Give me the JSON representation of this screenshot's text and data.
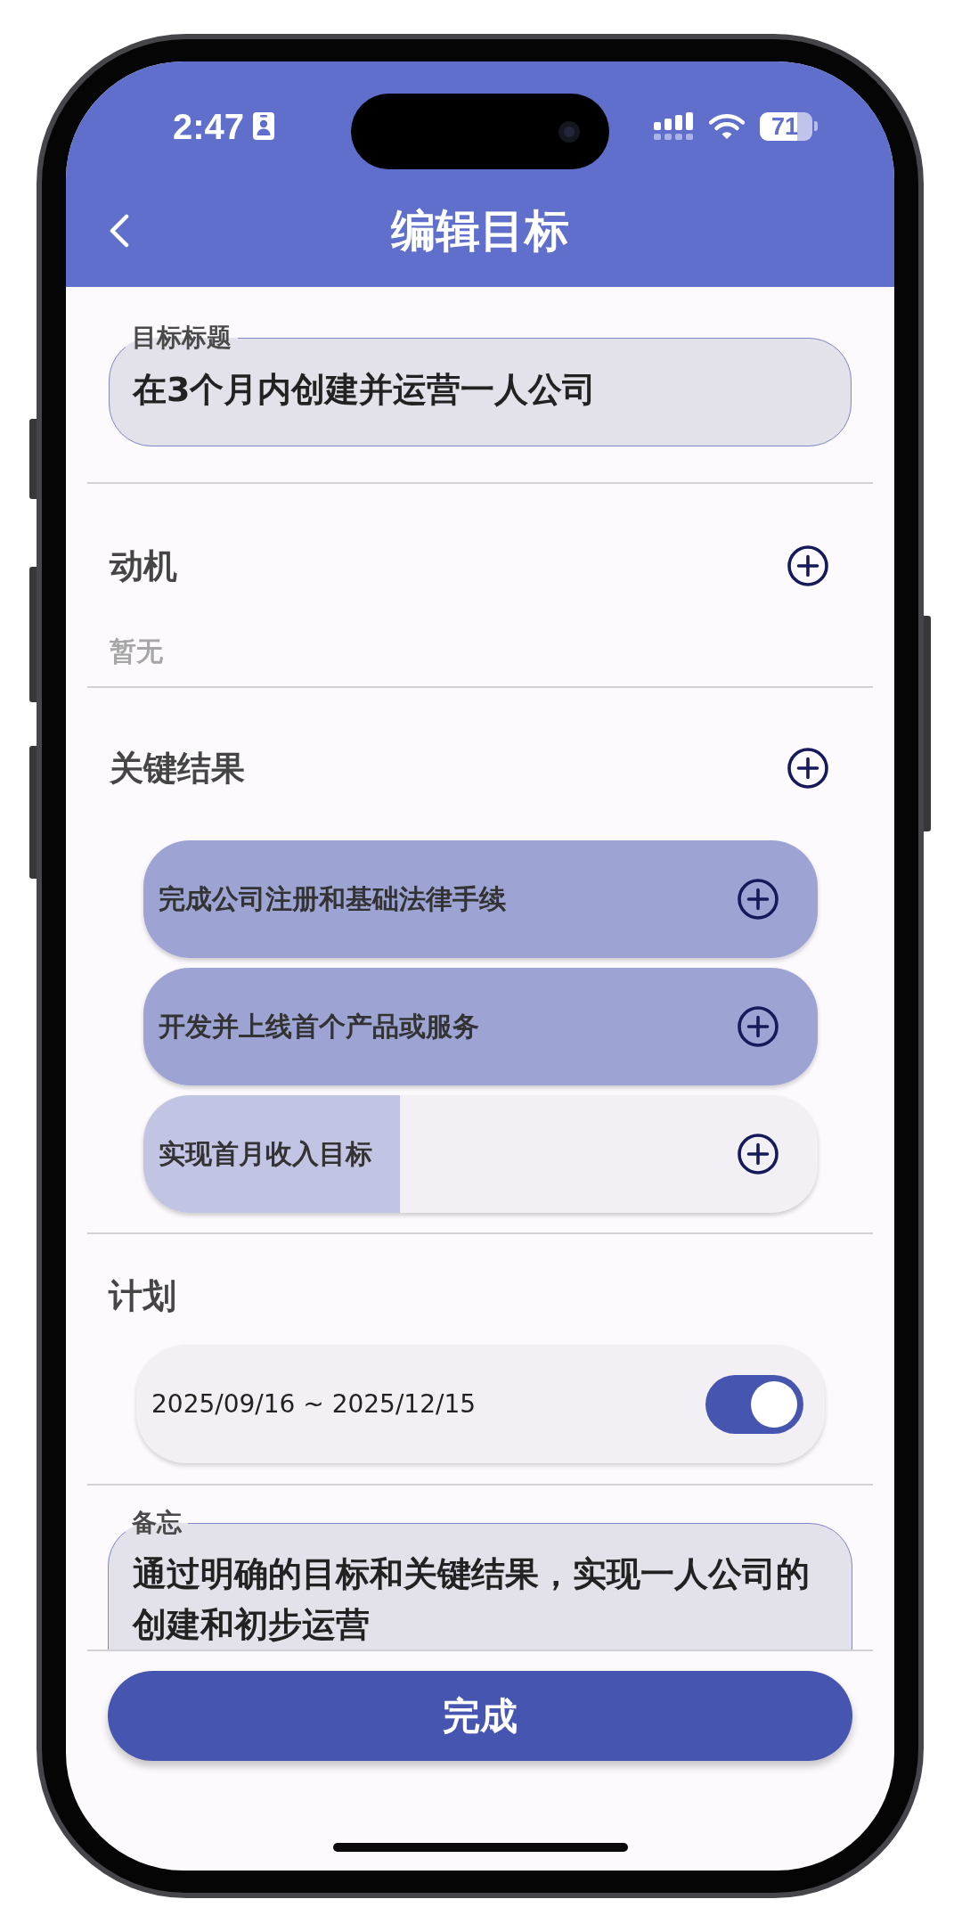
{
  "status_bar": {
    "time": "2:47",
    "battery": "71"
  },
  "header": {
    "title": "编辑目标"
  },
  "goal_title": {
    "label": "目标标题",
    "value": "在3个月内创建并运营一人公司"
  },
  "motivation": {
    "title": "动机",
    "empty_text": "暂无"
  },
  "key_results": {
    "title": "关键结果",
    "items": [
      {
        "text": "完成公司注册和基础法律手续",
        "level": 1
      },
      {
        "text": "开发并上线首个产品或服务",
        "level": 1
      },
      {
        "text": "实现首月收入目标",
        "level": 0.38
      }
    ]
  },
  "plan": {
    "title": "计划",
    "date_range": "2025/09/16 ~ 2025/12/15",
    "on": true
  },
  "memo": {
    "label": "备忘",
    "value": "通过明确的目标和关键结果，实现一人公司的创建和初步运营"
  },
  "done_button": {
    "label": "完成"
  }
}
